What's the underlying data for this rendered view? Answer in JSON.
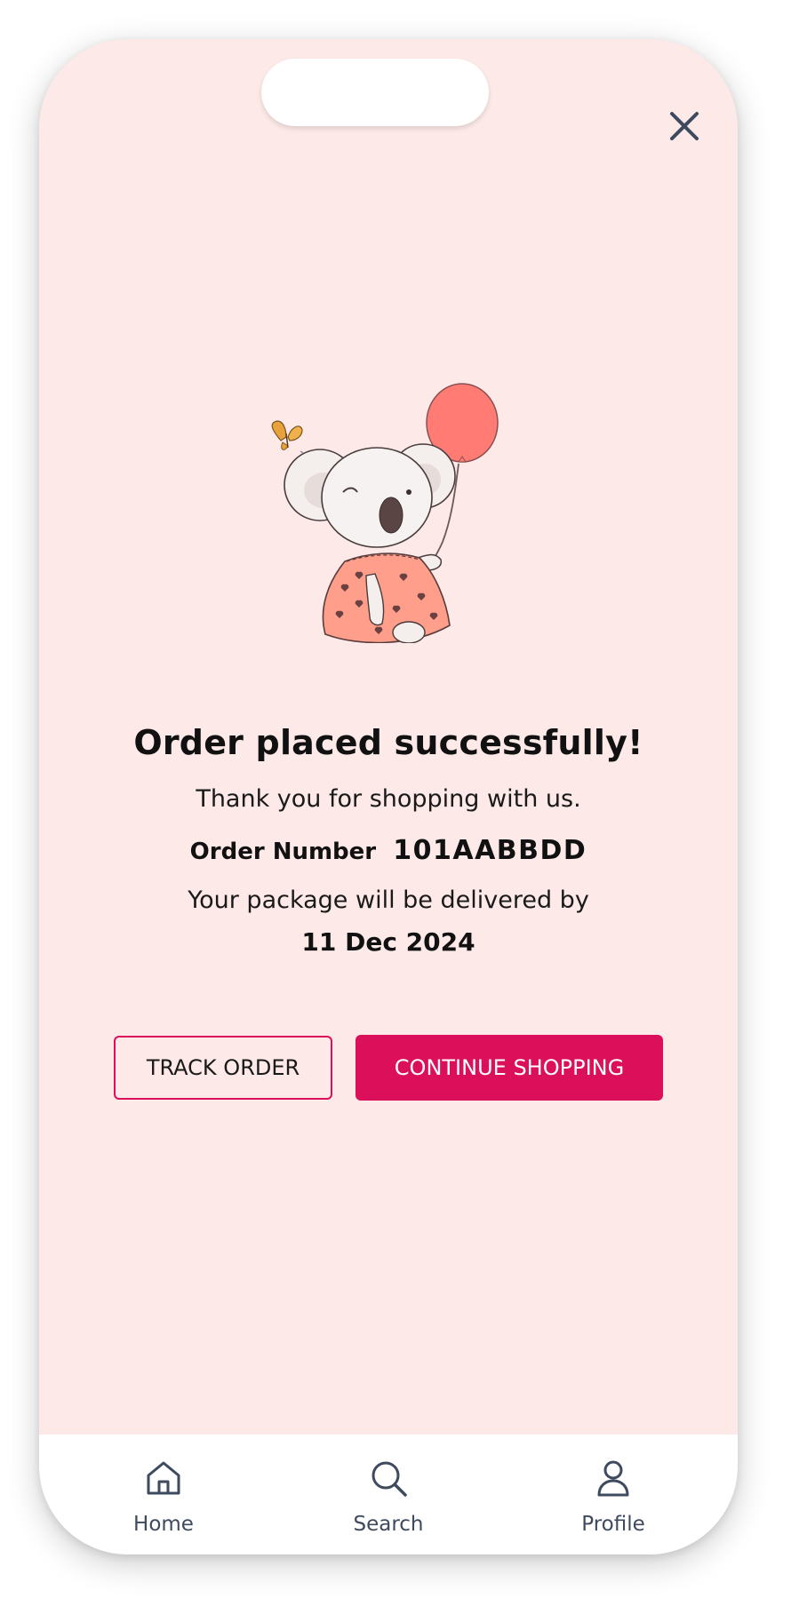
{
  "close_icon": "close-icon",
  "confirmation": {
    "title": "Order placed successfully!",
    "subtitle": "Thank you for shopping with us.",
    "order_label": "Order Number",
    "order_number": "101AABBDD",
    "delivery_text": "Your package will be delivered by",
    "delivery_date": "11 Dec 2024"
  },
  "actions": {
    "track_label": "TRACK ORDER",
    "continue_label": "CONTINUE SHOPPING"
  },
  "bottom_nav": {
    "items": [
      {
        "label": "Home",
        "icon": "home-icon"
      },
      {
        "label": "Search",
        "icon": "search-icon"
      },
      {
        "label": "Profile",
        "icon": "profile-icon"
      }
    ]
  },
  "colors": {
    "background": "#fde9e7",
    "accent": "#dc0f5a",
    "nav_text": "#3e4a5e",
    "balloon": "#ff7b74",
    "dress": "#ff9e8a"
  }
}
